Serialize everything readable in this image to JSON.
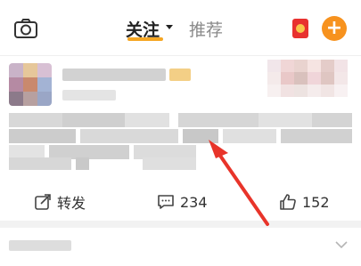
{
  "header": {
    "tabs": [
      {
        "label": "关注",
        "active": true
      },
      {
        "label": "推荐",
        "active": false
      }
    ],
    "icons": [
      "camera-icon",
      "red-packet-icon",
      "plus-icon"
    ],
    "accent_color": "#f5a623",
    "plus_color": "#f7921e"
  },
  "post": {
    "actions": {
      "repost_label": "转发",
      "comment_count": "234",
      "like_count": "152"
    }
  },
  "annotation": {
    "arrow_color": "#e8342a"
  }
}
